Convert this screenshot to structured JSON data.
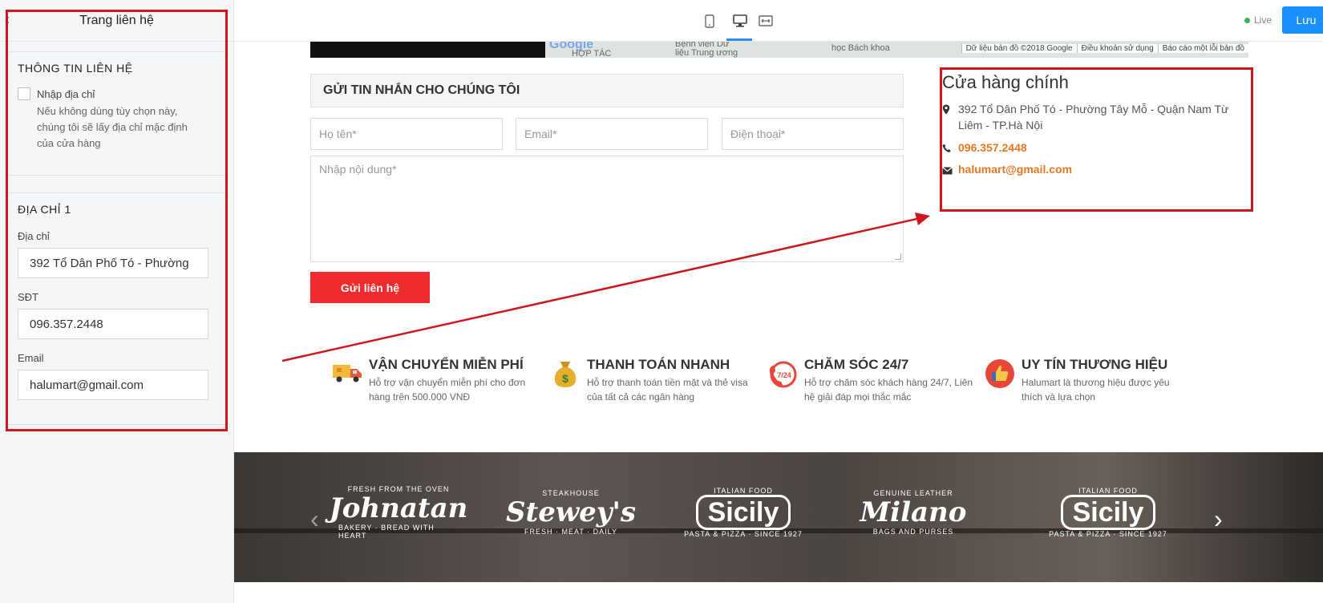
{
  "panel": {
    "title": "Trang liên hệ",
    "section1": {
      "heading": "THÔNG TIN LIÊN HỆ",
      "checkbox_label": "Nhập địa chỉ",
      "checkbox_help": "Nếu không dùng tùy chọn này, chúng tôi sẽ lấy địa chỉ mặc định của cửa hàng"
    },
    "section2": {
      "heading": "ĐỊA CHỈ 1",
      "address_label": "Địa chỉ",
      "address_value": "392 Tổ Dân Phố Tó - Phường",
      "phone_label": "SĐT",
      "phone_value": "096.357.2448",
      "email_label": "Email",
      "email_value": "halumart@gmail.com"
    }
  },
  "toolbar": {
    "live_label": "Live",
    "save_label": "Lưu"
  },
  "map": {
    "google": "Google",
    "text1": "Bệnh viện Dữ",
    "text2": "liệu Trung ương",
    "text3": "học Bách khoa",
    "text4": "HỢP TÁC",
    "footer": [
      "Dữ liệu bản đồ ©2018 Google",
      "Điều khoản sử dụng",
      "Báo cáo một lỗi bản đồ"
    ]
  },
  "form": {
    "title": "GỬI TIN NHẮN CHO CHÚNG TÔI",
    "name_placeholder": "Họ tên*",
    "email_placeholder": "Email*",
    "phone_placeholder": "Điện thoại*",
    "content_placeholder": "Nhập nội dung*",
    "submit_label": "Gửi liên hệ"
  },
  "store": {
    "title": "Cửa hàng chính",
    "address": "392 Tổ Dân Phố Tó - Phường Tây Mỗ - Quận Nam Từ Liêm - TP.Hà Nội",
    "phone": "096.357.2448",
    "email": "halumart@gmail.com"
  },
  "features": [
    {
      "title": "VẬN CHUYỂN MIỄN PHÍ",
      "desc": "Hỗ trợ vận chuyển miễn phí cho đơn hàng trên 500.000 VNĐ"
    },
    {
      "title": "THANH TOÁN NHANH",
      "desc": "Hỗ trợ thanh toán tiền mặt và thẻ visa của tất cả các ngân hàng"
    },
    {
      "title": "CHĂM SÓC 24/7",
      "desc": "Hỗ trợ chăm sóc khách hàng 24/7, Liên hệ giải đáp mọi thắc mắc"
    },
    {
      "title": "UY TÍN THƯƠNG HIỆU",
      "desc": "Halumart là thương hiệu được yêu thích và lựa chọn"
    }
  ],
  "brands": [
    {
      "top": "FRESH FROM THE OVEN",
      "main": "Johnatan",
      "bottom": "BAKERY · BREAD WITH HEART"
    },
    {
      "top": "STEAKHOUSE",
      "main": "Stewey's",
      "bottom": "FRESH · MEAT · DAILY"
    },
    {
      "top": "ITALIAN FOOD",
      "main": "Sicily",
      "bottom": "PASTA & PIZZA · SINCE 1927"
    },
    {
      "top": "GENUINE LEATHER",
      "main": "Milano",
      "bottom": "BAGS AND PURSES"
    },
    {
      "top": "ITALIAN FOOD",
      "main": "Sicily",
      "bottom": "PASTA & PIZZA · SINCE 1927"
    }
  ],
  "feature_icon_24": "7/24",
  "colors": {
    "accent_red": "#ef2b2d",
    "primary_blue": "#1890ff",
    "highlight_orange": "#e87722",
    "annotation_red": "#d0161b"
  }
}
